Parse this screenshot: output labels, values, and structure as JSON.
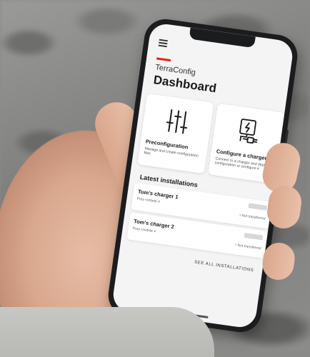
{
  "app": {
    "name": "TerraConfig",
    "page_title": "Dashboard"
  },
  "cards": [
    {
      "title": "Preconfiguration",
      "description": "Manage and create configuration files",
      "icon": "sliders-icon"
    },
    {
      "title": "Configure a charger",
      "description": "Connect to a charger and deploy configuration or configure it",
      "icon": "charger-plug-icon"
    }
  ],
  "latest_installations": {
    "title": "Latest installations",
    "items": [
      {
        "name": "Tom's charger 1",
        "address": "Pray rondele 4",
        "status": "Not transferred"
      },
      {
        "name": "Tom's charger 2",
        "address": "Pray rondele 4",
        "status": "Not transferred"
      }
    ],
    "see_all_label": "SEE ALL INSTALLATIONS"
  },
  "colors": {
    "accent": "#e2231a"
  }
}
